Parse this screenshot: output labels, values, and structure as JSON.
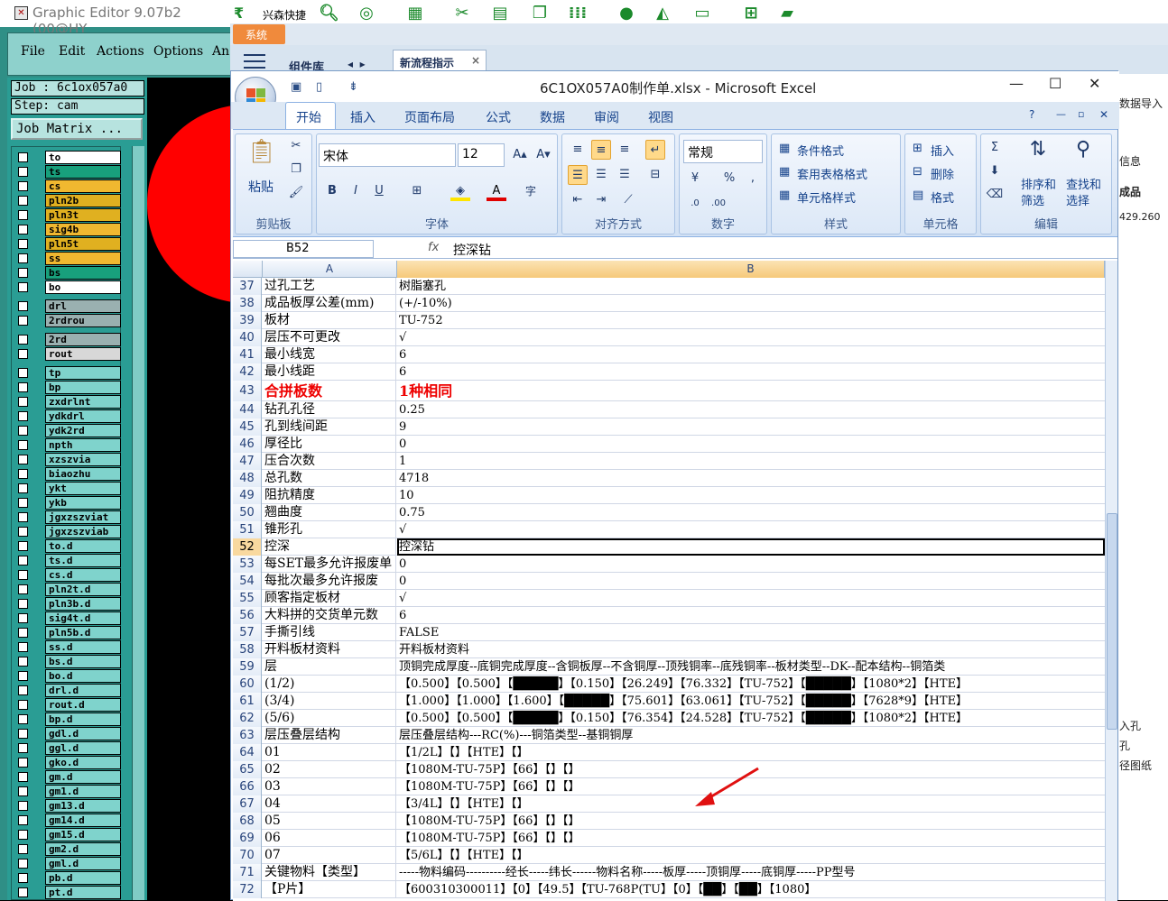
{
  "graphic_editor": {
    "title": "Graphic Editor 9.07b2 (00@HY",
    "menu": [
      "File",
      "Edit",
      "Actions",
      "Options",
      "An"
    ],
    "job": "Job : 6c1ox057a0",
    "step": "Step: cam",
    "job_matrix": "Job Matrix ...",
    "layers": [
      {
        "name": "to",
        "color": "#ffffff"
      },
      {
        "name": "ts",
        "color": "#18a07c"
      },
      {
        "name": "cs",
        "color": "#f0b830"
      },
      {
        "name": "pln2b",
        "color": "#e0b020"
      },
      {
        "name": "pln3t",
        "color": "#e0b020"
      },
      {
        "name": "sig4b",
        "color": "#f0b830"
      },
      {
        "name": "pln5t",
        "color": "#e0b020"
      },
      {
        "name": "ss",
        "color": "#f0b830"
      },
      {
        "name": "bs",
        "color": "#18a07c"
      },
      {
        "name": "bo",
        "color": "#ffffff"
      },
      {
        "name": "drl",
        "color": "#9ab0b0"
      },
      {
        "name": "2rdrou",
        "color": "#9ab0b0"
      },
      {
        "name": "2rd",
        "color": "#9ab0b0"
      },
      {
        "name": "rout",
        "color": "#d8d8d8"
      },
      {
        "name": "tp",
        "color": "#7fd3cc"
      },
      {
        "name": "bp",
        "color": "#7fd3cc"
      },
      {
        "name": "zxdrlnt",
        "color": "#7fd3cc"
      },
      {
        "name": "ydkdrl",
        "color": "#7fd3cc"
      },
      {
        "name": "ydk2rd",
        "color": "#7fd3cc"
      },
      {
        "name": "npth",
        "color": "#7fd3cc"
      },
      {
        "name": "xzszvia",
        "color": "#7fd3cc"
      },
      {
        "name": "biaozhu",
        "color": "#7fd3cc"
      },
      {
        "name": "ykt",
        "color": "#7fd3cc"
      },
      {
        "name": "ykb",
        "color": "#7fd3cc"
      },
      {
        "name": "jgxzszviat",
        "color": "#7fd3cc"
      },
      {
        "name": "jgxzszviab",
        "color": "#7fd3cc"
      },
      {
        "name": "to.d",
        "color": "#7fd3cc"
      },
      {
        "name": "ts.d",
        "color": "#7fd3cc"
      },
      {
        "name": "cs.d",
        "color": "#7fd3cc"
      },
      {
        "name": "pln2t.d",
        "color": "#7fd3cc"
      },
      {
        "name": "pln3b.d",
        "color": "#7fd3cc"
      },
      {
        "name": "sig4t.d",
        "color": "#7fd3cc"
      },
      {
        "name": "pln5b.d",
        "color": "#7fd3cc"
      },
      {
        "name": "ss.d",
        "color": "#7fd3cc"
      },
      {
        "name": "bs.d",
        "color": "#7fd3cc"
      },
      {
        "name": "bo.d",
        "color": "#7fd3cc"
      },
      {
        "name": "drl.d",
        "color": "#7fd3cc"
      },
      {
        "name": "rout.d",
        "color": "#7fd3cc"
      },
      {
        "name": "bp.d",
        "color": "#7fd3cc"
      },
      {
        "name": "gdl.d",
        "color": "#7fd3cc"
      },
      {
        "name": "ggl.d",
        "color": "#7fd3cc"
      },
      {
        "name": "gko.d",
        "color": "#7fd3cc"
      },
      {
        "name": "gm.d",
        "color": "#7fd3cc"
      },
      {
        "name": "gm1.d",
        "color": "#7fd3cc"
      },
      {
        "name": "gm13.d",
        "color": "#7fd3cc"
      },
      {
        "name": "gm14.d",
        "color": "#7fd3cc"
      },
      {
        "name": "gm15.d",
        "color": "#7fd3cc"
      },
      {
        "name": "gm2.d",
        "color": "#7fd3cc"
      },
      {
        "name": "gml.d",
        "color": "#7fd3cc"
      },
      {
        "name": "pb.d",
        "color": "#7fd3cc"
      },
      {
        "name": "pt.d",
        "color": "#7fd3cc"
      }
    ]
  },
  "topbar": {
    "app_label": "兴森快捷",
    "system_button": "系统",
    "tab_component": "组件库",
    "tab_new": "新流程指示"
  },
  "right_app": {
    "texts": [
      "数据导入",
      "信息",
      "成品",
      "429.260",
      "入孔",
      "孔",
      "径图纸"
    ]
  },
  "excel": {
    "title": "6C1OX057A0制作单.xlsx - Microsoft Excel",
    "ribbon_tabs": [
      "开始",
      "插入",
      "页面布局",
      "公式",
      "数据",
      "审阅",
      "视图"
    ],
    "clipboard": {
      "paste": "粘贴",
      "group": "剪贴板"
    },
    "font": {
      "name": "宋体",
      "size": "12",
      "group": "字体"
    },
    "align_group": "对齐方式",
    "number": {
      "format": "常规",
      "group": "数字"
    },
    "styles": {
      "items": [
        "条件格式",
        "套用表格格式",
        "单元格样式"
      ],
      "group": "样式"
    },
    "cells": {
      "items": [
        "插入",
        "删除",
        "格式"
      ],
      "group": "单元格"
    },
    "edit": {
      "sort": "排序和\n筛选",
      "find": "查找和\n选择",
      "group": "编辑"
    },
    "name_box": "B52",
    "formula": "控深钻",
    "col_headers": [
      "A",
      "B"
    ],
    "rows": [
      {
        "n": "37",
        "a": "过孔工艺",
        "b": "树脂塞孔"
      },
      {
        "n": "38",
        "a": "成品板厚公差(mm)",
        "b": "(+/-10%)"
      },
      {
        "n": "39",
        "a": "板材",
        "b": "TU-752"
      },
      {
        "n": "40",
        "a": "层压不可更改",
        "b": "√"
      },
      {
        "n": "41",
        "a": "最小线宽",
        "b": "6"
      },
      {
        "n": "42",
        "a": "最小线距",
        "b": "6"
      },
      {
        "n": "43",
        "a": "合拼板数",
        "b": "1种相同"
      },
      {
        "n": "44",
        "a": "钻孔孔径",
        "b": "0.25"
      },
      {
        "n": "45",
        "a": "孔到线间距",
        "b": "9"
      },
      {
        "n": "46",
        "a": "厚径比",
        "b": "0"
      },
      {
        "n": "47",
        "a": "压合次数",
        "b": "1"
      },
      {
        "n": "48",
        "a": "总孔数",
        "b": "4718"
      },
      {
        "n": "49",
        "a": "阻抗精度",
        "b": "10"
      },
      {
        "n": "50",
        "a": "翘曲度",
        "b": "0.75"
      },
      {
        "n": "51",
        "a": "锥形孔",
        "b": "√"
      },
      {
        "n": "52",
        "a": "控深",
        "b": "控深钻"
      },
      {
        "n": "53",
        "a": "每SET最多允许报废单",
        "b": "0"
      },
      {
        "n": "54",
        "a": "每批次最多允许报废",
        "b": "0"
      },
      {
        "n": "55",
        "a": "顾客指定板材",
        "b": "√"
      },
      {
        "n": "56",
        "a": "大料拼的交货单元数",
        "b": "6"
      },
      {
        "n": "57",
        "a": "手撕引线",
        "b": "FALSE"
      },
      {
        "n": "58",
        "a": "开料板材资料",
        "b": "开料板材资料"
      },
      {
        "n": "59",
        "a": "层",
        "b": "顶铜完成厚度--底铜完成厚度--含铜板厚--不含铜厚--顶残铜率--底残铜率--板材类型--DK--配本结构--铜箔类"
      },
      {
        "n": "60",
        "a": "(1/2)",
        "b": "【0.500】【0.500】【█████】【0.150】【26.249】【76.332】【TU-752】【█████】【1080*2】【HTE】"
      },
      {
        "n": "61",
        "a": "(3/4)",
        "b": "【1.000】【1.000】【1.600】【█████】【75.601】【63.061】【TU-752】【█████】【7628*9】【HTE】"
      },
      {
        "n": "62",
        "a": "(5/6)",
        "b": "【0.500】【0.500】【█████】【0.150】【76.354】【24.528】【TU-752】【█████】【1080*2】【HTE】"
      },
      {
        "n": "63",
        "a": "层压叠层结构",
        "b": "层压叠层结构---RC(%)---铜箔类型--基铜铜厚"
      },
      {
        "n": "64",
        "a": "01",
        "b": "【1/2L】【】【HTE】【】"
      },
      {
        "n": "65",
        "a": "02",
        "b": "【1080M-TU-75P】【66】【】【】"
      },
      {
        "n": "66",
        "a": "03",
        "b": "【1080M-TU-75P】【66】【】【】"
      },
      {
        "n": "67",
        "a": "04",
        "b": "【3/4L】【】【HTE】【】"
      },
      {
        "n": "68",
        "a": "05",
        "b": "【1080M-TU-75P】【66】【】【】"
      },
      {
        "n": "69",
        "a": "06",
        "b": "【1080M-TU-75P】【66】【】【】"
      },
      {
        "n": "70",
        "a": "07",
        "b": "【5/6L】【】【HTE】【】"
      },
      {
        "n": "71",
        "a": "关键物料【类型】",
        "b": "-----物料编码----------经长-----纬长------物料名称-----板厚-----顶铜厚-----底铜厚-----PP型号"
      },
      {
        "n": "72",
        "a": "【P片】",
        "b": "【600310300011】【0】【49.5】【TU-768P(TU】【0】【██】【██】【1080】"
      }
    ],
    "selected_row": "52",
    "highlight_row": "43"
  }
}
